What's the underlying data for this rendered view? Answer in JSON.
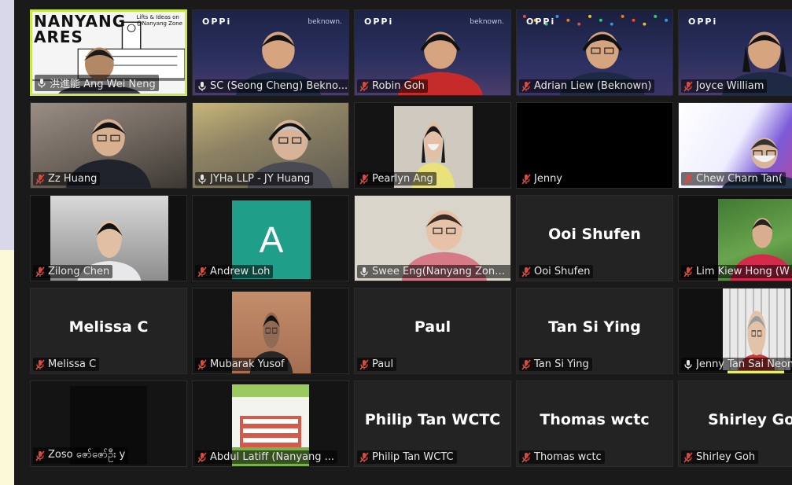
{
  "participants": [
    {
      "label": "洪進能 Ang Wei Neng",
      "center_name": "",
      "muted": false,
      "active": true,
      "bg": "poster",
      "poster_title": "NANYANG\nARES",
      "poster_caption": "Lifts & Ideas on\n@Nanyang Zone"
    },
    {
      "label": "SC (Seong Cheng) Bekno...",
      "center_name": "",
      "muted": false,
      "active": false,
      "bg": "oppi",
      "oppi": "OPPi",
      "brand": "beknown."
    },
    {
      "label": "Robin Goh",
      "center_name": "",
      "muted": true,
      "active": false,
      "bg": "oppi",
      "oppi": "OPPi",
      "brand": "beknown."
    },
    {
      "label": "Adrian Liew (Beknown)",
      "center_name": "",
      "muted": true,
      "active": false,
      "bg": "oppi-lights",
      "oppi": "OPPi",
      "brand": ""
    },
    {
      "label": "Joyce William",
      "center_name": "",
      "muted": true,
      "active": false,
      "bg": "oppi",
      "oppi": "OPPi",
      "brand": ""
    },
    {
      "label": "Zz Huang",
      "center_name": "",
      "muted": true,
      "active": false,
      "bg": "room"
    },
    {
      "label": "JYHa LLP - JY Huang",
      "center_name": "",
      "muted": false,
      "active": false,
      "bg": "room2"
    },
    {
      "label": "Pearlyn Ang",
      "center_name": "",
      "muted": true,
      "active": false,
      "bg": "pearlyn"
    },
    {
      "label": "Jenny",
      "center_name": "",
      "muted": true,
      "active": false,
      "bg": "dark"
    },
    {
      "label": "Chew Charn Tan(",
      "center_name": "",
      "muted": true,
      "active": false,
      "bg": "chew"
    },
    {
      "label": "Zilong Chen",
      "center_name": "",
      "muted": true,
      "active": false,
      "bg": "zilong"
    },
    {
      "label": "Andrew Loh",
      "center_name": "",
      "muted": true,
      "active": false,
      "bg": "avatar",
      "avatar_letter": "A"
    },
    {
      "label": "Swee Eng(Nanyang Zone ...",
      "center_name": "",
      "muted": false,
      "active": false,
      "bg": "swee"
    },
    {
      "label": "Ooi Shufen",
      "center_name": "Ooi Shufen",
      "muted": true,
      "active": false,
      "bg": "plain"
    },
    {
      "label": "Lim Kiew Hong (W",
      "center_name": "",
      "muted": true,
      "active": false,
      "bg": "lim"
    },
    {
      "label": "Melissa C",
      "center_name": "Melissa C",
      "muted": true,
      "active": false,
      "bg": "plain"
    },
    {
      "label": "Mubarak Yusof",
      "center_name": "",
      "muted": true,
      "active": false,
      "bg": "mubarak"
    },
    {
      "label": "Paul",
      "center_name": "Paul",
      "muted": true,
      "active": false,
      "bg": "plain"
    },
    {
      "label": "Tan Si Ying",
      "center_name": "Tan Si Ying",
      "muted": true,
      "active": false,
      "bg": "plain"
    },
    {
      "label": "Jenny Tan Sai Neon",
      "center_name": "",
      "muted": false,
      "active": false,
      "bg": "jennytan"
    },
    {
      "label": "Zoso ဇော်ဇော်ဦး y",
      "center_name": "",
      "muted": true,
      "active": false,
      "bg": "zoso"
    },
    {
      "label": "Abdul Latiff (Nanyang ...",
      "center_name": "",
      "muted": true,
      "active": false,
      "bg": "abdul"
    },
    {
      "label": "Philip Tan WCTC",
      "center_name": "Philip Tan WCTC",
      "muted": true,
      "active": false,
      "bg": "plain"
    },
    {
      "label": "Thomas wctc",
      "center_name": "Thomas wctc",
      "muted": true,
      "active": false,
      "bg": "plain"
    },
    {
      "label": "Shirley Goh",
      "center_name": "Shirley Goh",
      "muted": true,
      "active": false,
      "bg": "plain"
    }
  ],
  "colors": {
    "active_border": "#c7e84a",
    "muted_icon": "#e0483e",
    "avatar_green": "#1f9e8a",
    "tile_bg": "#232323"
  }
}
